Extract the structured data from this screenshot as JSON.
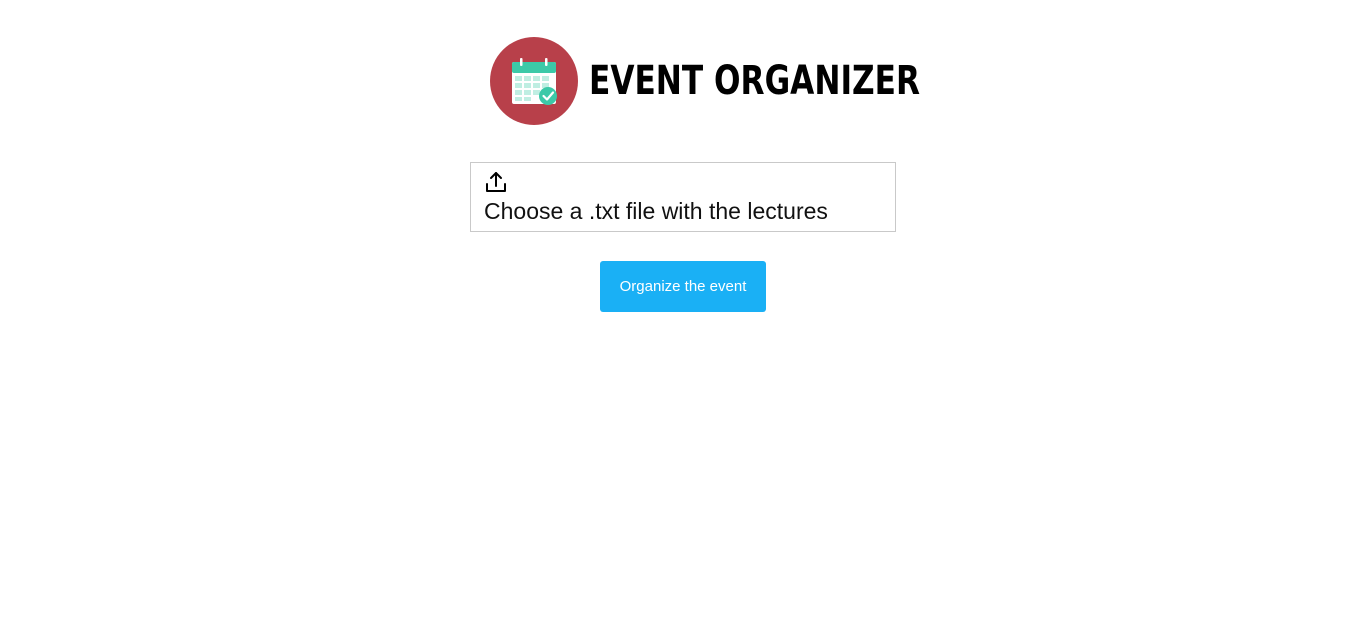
{
  "header": {
    "logo_icon": "calendar-check-icon",
    "title": "EVENT ORGANIZER"
  },
  "upload": {
    "icon": "upload-icon",
    "label": "Choose a .txt file with the lectures"
  },
  "actions": {
    "submit_label": "Organize the event"
  },
  "colors": {
    "logo_circle": "#b8404a",
    "calendar_header": "#3cc9a8",
    "check_badge": "#3cc9a8",
    "button_bg": "#1ab0f5",
    "button_text": "#ffffff",
    "title_text": "#000000"
  }
}
